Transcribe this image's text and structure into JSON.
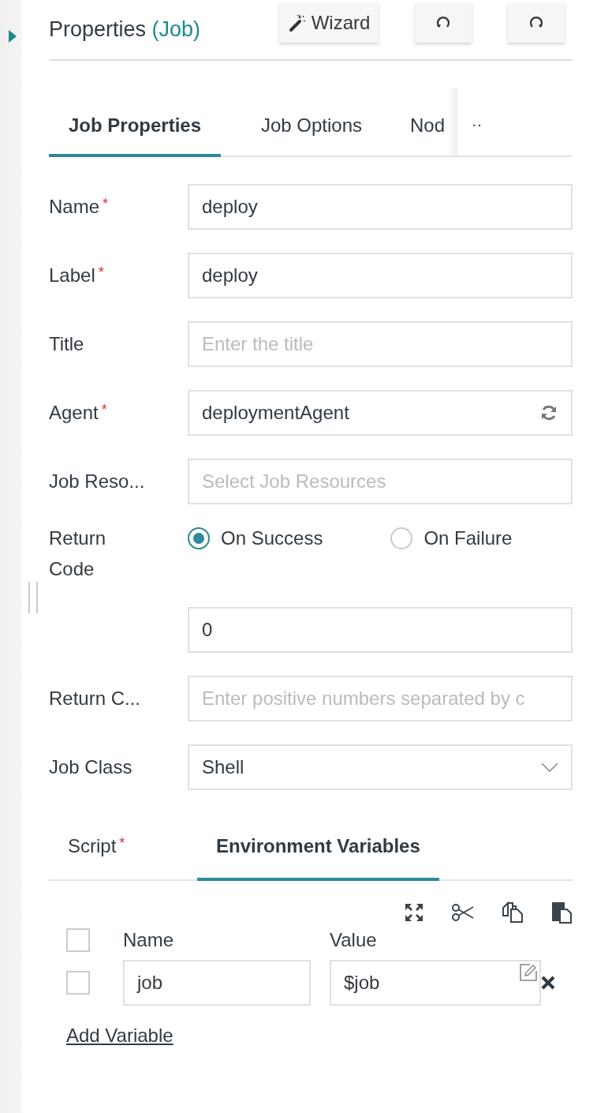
{
  "header": {
    "title": "Properties",
    "subtitle": "(Job)",
    "buttons": [
      {
        "kind": "wizard",
        "label": "Wizard"
      },
      {
        "kind": "undo"
      },
      {
        "kind": "redo"
      }
    ]
  },
  "tabs": [
    {
      "label": "Job Properties",
      "selected": true
    },
    {
      "label": "Job Options",
      "selected": false
    },
    {
      "label": "Nod",
      "selected": false
    }
  ],
  "tabs_more": "··",
  "required_mark": "*",
  "fields": [
    {
      "kind": "text",
      "label": "Name",
      "required": true,
      "value": "deploy"
    },
    {
      "kind": "text",
      "label": "Label",
      "required": true,
      "value": "deploy"
    },
    {
      "kind": "text",
      "label": "Title",
      "required": false,
      "placeholder": "Enter the title"
    },
    {
      "kind": "refresh",
      "label": "Agent",
      "required": true,
      "value": "deploymentAgent"
    },
    {
      "kind": "text",
      "label": "Job Reso...",
      "required": false,
      "placeholder": "Select Job Resources"
    },
    {
      "kind": "radio",
      "label": "Return Code",
      "required": false,
      "options": [
        {
          "label": "On Success",
          "selected": true
        },
        {
          "label": "On Failure",
          "selected": false
        }
      ]
    },
    {
      "kind": "text",
      "required": false,
      "value": "0"
    },
    {
      "kind": "text",
      "label": "Return C...",
      "required": false,
      "placeholder": "Enter positive numbers separated by c"
    },
    {
      "kind": "select",
      "label": "Job Class",
      "required": false,
      "value": "Shell"
    }
  ],
  "subtabs": [
    {
      "label": "Script",
      "required": true,
      "selected": false
    },
    {
      "label": "Environment Variables",
      "required": false,
      "selected": true
    }
  ],
  "table": {
    "all_checked": false,
    "columns": [
      "Name",
      "Value"
    ],
    "rows": [
      {
        "checked": false,
        "name": "job",
        "value": "$job"
      }
    ]
  },
  "add_link": "Add Variable"
}
